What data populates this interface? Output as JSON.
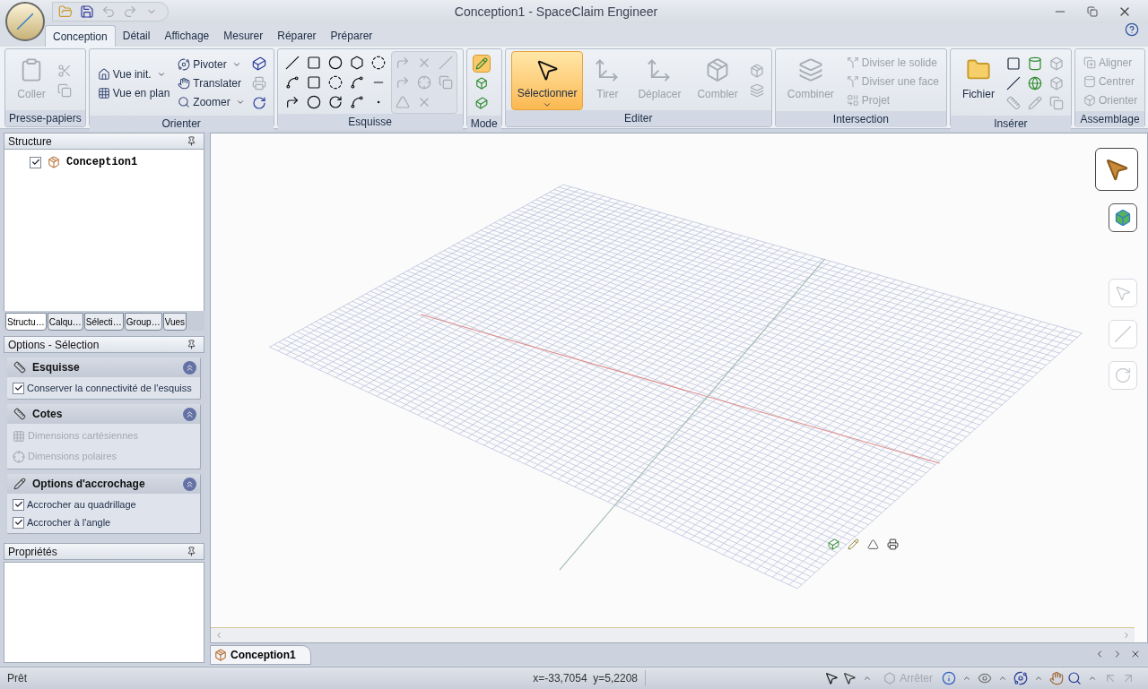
{
  "window": {
    "title": "Conception1 - SpaceClaim Engineer"
  },
  "tabs": [
    {
      "label": "Conception",
      "selected": true
    },
    {
      "label": "Détail",
      "selected": false
    },
    {
      "label": "Affichage",
      "selected": false
    },
    {
      "label": "Mesurer",
      "selected": false
    },
    {
      "label": "Réparer",
      "selected": false
    },
    {
      "label": "Préparer",
      "selected": false
    }
  ],
  "ribbon_groups": [
    {
      "label": "Presse-papiers",
      "columns": [
        [
          {
            "kind": "large",
            "label": "Coller",
            "disabled": true,
            "dropdown": false,
            "selected": false
          }
        ]
      ]
    },
    {
      "label": "Orienter",
      "columns": [
        [
          {
            "kind": "small",
            "label": "Vue init.",
            "disabled": false,
            "dropdown": true
          },
          {
            "kind": "small",
            "label": "Vue en plan",
            "disabled": false,
            "dropdown": false
          }
        ],
        [
          {
            "kind": "small",
            "label": "Pivoter",
            "disabled": false,
            "dropdown": true
          },
          {
            "kind": "small",
            "label": "Translater",
            "disabled": false,
            "dropdown": false
          },
          {
            "kind": "small",
            "label": "Zoomer",
            "disabled": false,
            "dropdown": true
          }
        ]
      ]
    },
    {
      "label": "Esquisse"
    },
    {
      "label": "Mode",
      "buttons": [
        {
          "selected": true
        },
        {
          "selected": false
        },
        {
          "selected": false
        }
      ]
    },
    {
      "label": "Editer",
      "columns": [
        [
          {
            "kind": "large",
            "label": "Sélectionner",
            "disabled": false,
            "dropdown": true,
            "selected": true
          }
        ],
        [
          {
            "kind": "large",
            "label": "Tirer",
            "disabled": true,
            "dropdown": false,
            "selected": false
          }
        ],
        [
          {
            "kind": "large",
            "label": "Déplacer",
            "disabled": true,
            "dropdown": false,
            "selected": false
          }
        ],
        [
          {
            "kind": "large",
            "label": "Combler",
            "disabled": true,
            "dropdown": false,
            "selected": false
          }
        ]
      ]
    },
    {
      "label": "Intersection",
      "columns": [
        [
          {
            "kind": "large",
            "label": "Combiner",
            "disabled": true,
            "dropdown": false,
            "selected": false
          }
        ],
        [
          {
            "kind": "small",
            "label": "Diviser le solide",
            "disabled": true,
            "dropdown": false
          },
          {
            "kind": "small",
            "label": "Diviser une face",
            "disabled": true,
            "dropdown": false
          },
          {
            "kind": "small",
            "label": "Projet",
            "disabled": true,
            "dropdown": false
          }
        ]
      ]
    },
    {
      "label": "Insérer",
      "columns": [
        [
          {
            "kind": "large",
            "label": "Fichier",
            "disabled": false,
            "dropdown": false,
            "selected": false
          }
        ]
      ]
    },
    {
      "label": "Assemblage",
      "columns": [
        [
          {
            "kind": "small",
            "label": "Aligner",
            "disabled": true,
            "dropdown": false
          },
          {
            "kind": "small",
            "label": "Centrer",
            "disabled": true,
            "dropdown": false
          },
          {
            "kind": "small",
            "label": "Orienter",
            "disabled": true,
            "dropdown": false
          }
        ]
      ]
    }
  ],
  "structure_panel": {
    "title": "Structure",
    "tree": [
      {
        "label": "Conception1",
        "checked": true
      }
    ],
    "tabs": [
      {
        "label": "Structu…",
        "selected": true
      },
      {
        "label": "Calqu…",
        "selected": false
      },
      {
        "label": "Sélecti…",
        "selected": false
      },
      {
        "label": "Group…",
        "selected": false
      },
      {
        "label": "Vues",
        "selected": false
      }
    ]
  },
  "options_panel": {
    "title": "Options - Sélection",
    "sections": [
      {
        "title": "Esquisse",
        "expanded": true,
        "options": [
          {
            "kind": "checkbox",
            "label": "Conserver la connectivité de l'esquiss",
            "checked": true
          }
        ]
      },
      {
        "title": "Cotes",
        "expanded": true,
        "options": [
          {
            "kind": "button",
            "label": "Dimensions cartésiennes",
            "disabled": true
          },
          {
            "kind": "button",
            "label": "Dimensions polaires",
            "disabled": true
          }
        ]
      },
      {
        "title": "Options d'accrochage",
        "expanded": true,
        "options": [
          {
            "kind": "checkbox",
            "label": "Accrocher au quadrillage",
            "checked": true
          },
          {
            "kind": "checkbox",
            "label": "Accrocher à l'angle",
            "checked": true
          }
        ]
      }
    ]
  },
  "properties_panel": {
    "title": "Propriétés"
  },
  "viewport": {
    "tools": [
      {
        "kind": "large",
        "disabled": false
      },
      {
        "kind": "small",
        "disabled": false
      },
      {
        "kind": "small",
        "disabled": true
      },
      {
        "kind": "small",
        "disabled": true
      },
      {
        "kind": "small",
        "disabled": true
      }
    ]
  },
  "doc_tabs": [
    {
      "label": "Conception1",
      "selected": true
    }
  ],
  "status_bar": {
    "text": "Prêt",
    "coordinates": "x=-33,7054  y=5,2208",
    "stop_button": {
      "label": "Arrêter",
      "disabled": true
    }
  }
}
